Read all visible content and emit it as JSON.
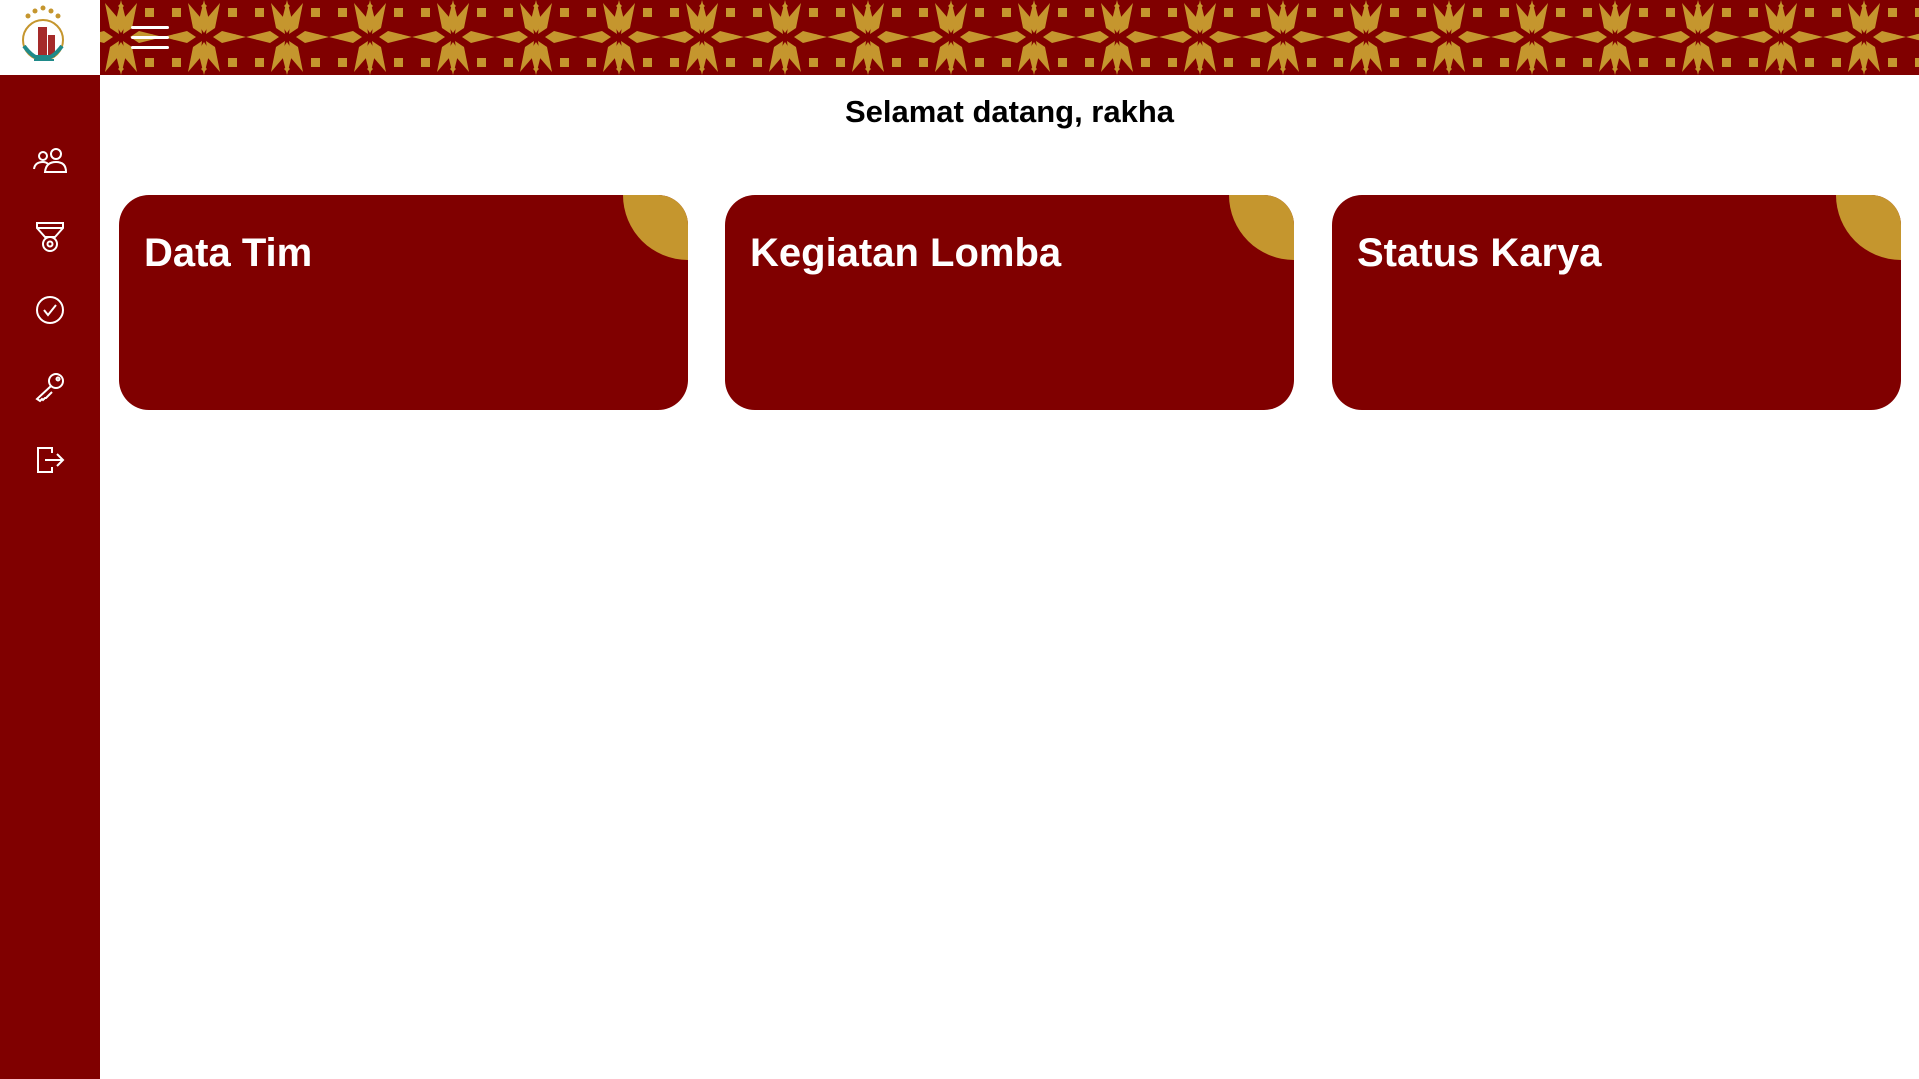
{
  "colors": {
    "primary": "#800000",
    "accent": "#c5962e"
  },
  "header": {
    "menu_icon": "hamburger-icon"
  },
  "sidebar": {
    "items": [
      {
        "icon": "users-icon"
      },
      {
        "icon": "medal-icon"
      },
      {
        "icon": "check-circle-icon"
      },
      {
        "icon": "key-icon"
      },
      {
        "icon": "logout-icon"
      }
    ]
  },
  "main": {
    "welcome": "Selamat datang, rakha",
    "cards": [
      {
        "label": "Data Tim"
      },
      {
        "label": "Kegiatan Lomba"
      },
      {
        "label": "Status Karya"
      }
    ]
  }
}
